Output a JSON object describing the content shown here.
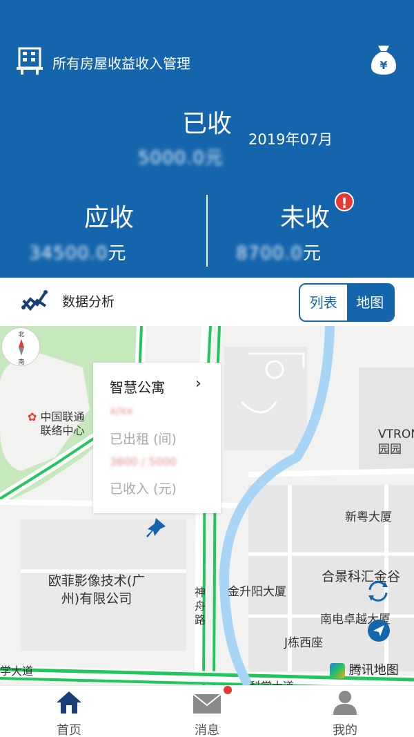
{
  "header": {
    "title": "所有房屋收益收入管理",
    "received_label": "已收",
    "month": "2019年07月",
    "received_amount": "5000.0元",
    "due_label": "应收",
    "due_amount": "34500.0",
    "unpaid_label": "未收",
    "unpaid_amount": "8700.0",
    "currency_unit": "元",
    "alert_badge": "!",
    "icons": {
      "left": "building-icon",
      "right": "money-bag-icon"
    }
  },
  "toolbar": {
    "analysis_label": "数据分析",
    "view_toggle": {
      "options": [
        "列表",
        "地图"
      ],
      "selected": "地图"
    }
  },
  "map": {
    "compass": {
      "north": "北",
      "south": "南"
    },
    "popup": {
      "title": "智慧公寓",
      "blurred_line_1": "x/xx",
      "rented_label": "已出租 (间)",
      "blurred_line_2": "3600 / 5000",
      "income_label": "已收入 (元)"
    },
    "labels": {
      "unicom": "中国联通联络中心",
      "vtron": "VTRON园园",
      "xinyue": "新粤大厦",
      "hejing": "合景科汇金谷",
      "jinshengyang": "金升阳大厦",
      "oufei": "欧菲影像技术(广州)有限公司",
      "shenzhou_road": "神舟路",
      "nandian": "南电卓越大厦",
      "j_west": "J栋西座",
      "science_avenue_left": "学大道",
      "science_avenue_right": "科学大道"
    },
    "logo": "腾讯地图"
  },
  "bottom_nav": {
    "items": [
      {
        "label": "首页",
        "icon": "home-icon",
        "active": true
      },
      {
        "label": "消息",
        "icon": "mail-icon",
        "has_dot": true
      },
      {
        "label": "我的",
        "icon": "user-icon"
      }
    ]
  },
  "colors": {
    "primary": "#1565ad",
    "alert": "#e53935",
    "road_green": "#22c55e",
    "river": "#a8d4f5"
  }
}
